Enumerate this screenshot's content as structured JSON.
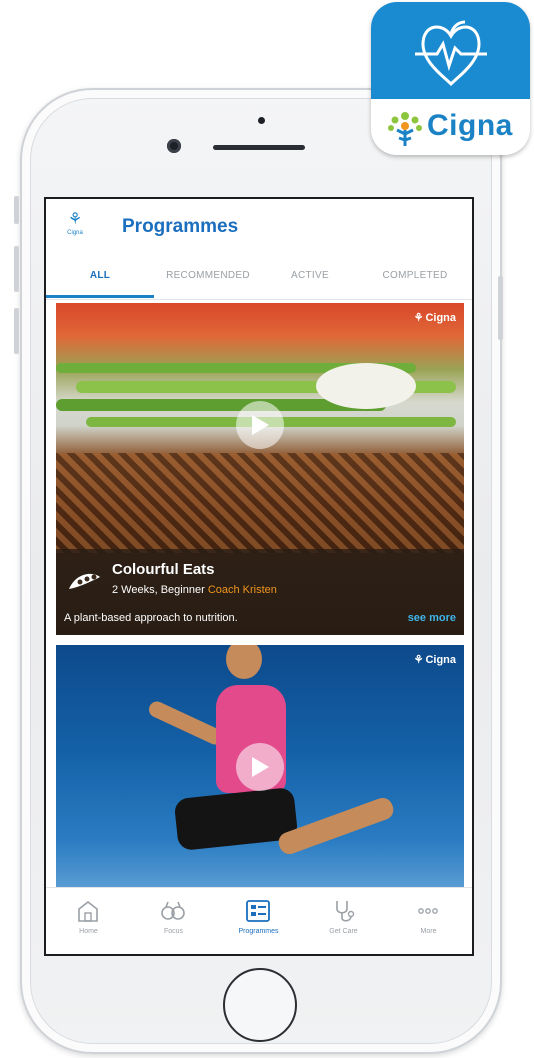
{
  "app_badge": {
    "wordmark": "Cigna"
  },
  "header": {
    "logo_text": "Cigna",
    "title": "Programmes"
  },
  "tabs": [
    {
      "label": "ALL",
      "active": true
    },
    {
      "label": "RECOMMENDED",
      "active": false
    },
    {
      "label": "ACTIVE",
      "active": false
    },
    {
      "label": "COMPLETED",
      "active": false
    }
  ],
  "cards": [
    {
      "brand": "Cigna",
      "title": "Colourful Eats",
      "meta": "2 Weeks, Beginner",
      "coach": "Coach Kristen",
      "description": "A plant-based approach to nutrition.",
      "see_more": "see more"
    },
    {
      "brand": "Cigna"
    }
  ],
  "bottom_nav": [
    {
      "label": "Home",
      "icon": "home-icon",
      "active": false
    },
    {
      "label": "Focus",
      "icon": "focus-icon",
      "active": false
    },
    {
      "label": "Programmes",
      "icon": "programmes-icon",
      "active": true
    },
    {
      "label": "Get Care",
      "icon": "stethoscope-icon",
      "active": false
    },
    {
      "label": "More",
      "icon": "more-icon",
      "active": false
    }
  ],
  "colors": {
    "brand_blue": "#1b6fbe",
    "accent_blue": "#1b82c5",
    "coach_orange": "#f0961e",
    "see_more_cyan": "#3fb5e8",
    "badge_blue": "#1a8bd1"
  }
}
